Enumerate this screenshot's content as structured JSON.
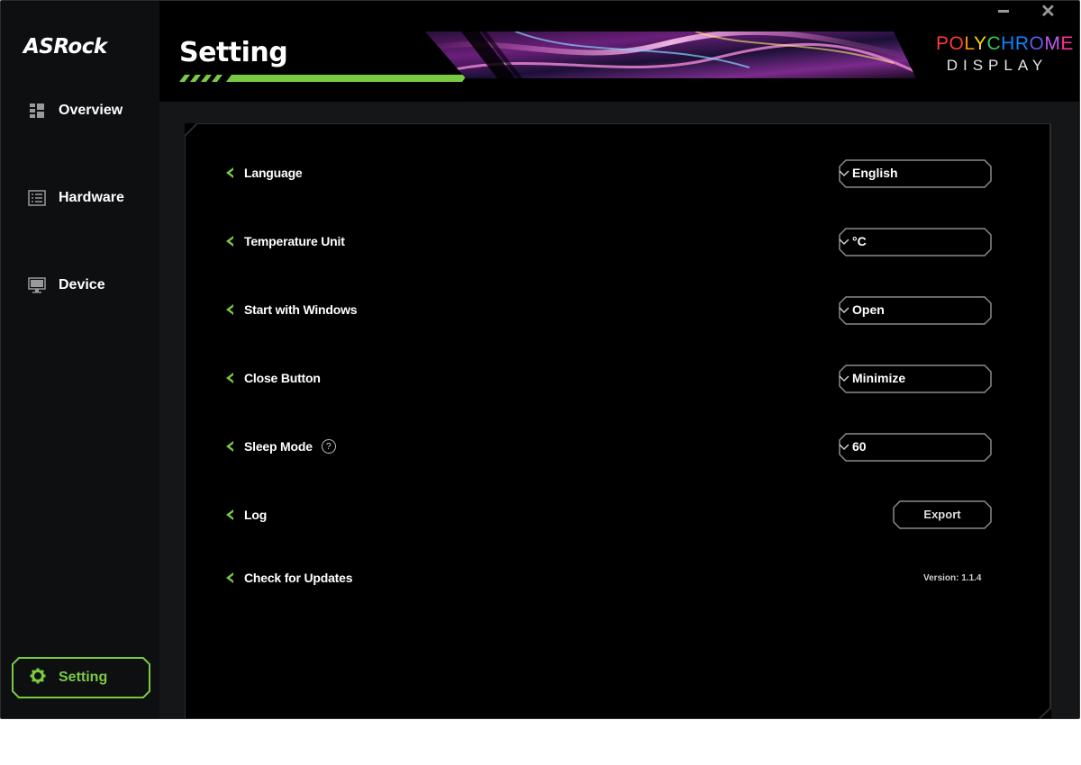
{
  "sidebar": {
    "logo": "ASRock",
    "items": [
      {
        "label": "Overview",
        "icon": "grid-icon"
      },
      {
        "label": "Hardware",
        "icon": "list-icon"
      },
      {
        "label": "Device",
        "icon": "monitor-icon"
      }
    ],
    "active": {
      "label": "Setting",
      "icon": "gear-icon"
    }
  },
  "header": {
    "title": "Setting",
    "brand_top": "POLYCHROME",
    "brand_bottom": "DISPLAY",
    "brand_colors": [
      "#ff3b30",
      "#ff9500",
      "#ffd60a",
      "#34c759",
      "#0a84ff",
      "#5e5ce6",
      "#bf5af2",
      "#ff2d92"
    ]
  },
  "settings": {
    "language": {
      "label": "Language",
      "value": "English"
    },
    "temperature": {
      "label": "Temperature Unit",
      "value": "°C"
    },
    "startup": {
      "label": "Start with Windows",
      "value": "Open"
    },
    "close": {
      "label": "Close Button",
      "value": "Minimize"
    },
    "sleep": {
      "label": "Sleep Mode",
      "value": "60",
      "help": "?"
    },
    "log": {
      "label": "Log",
      "button": "Export"
    },
    "updates": {
      "label": "Check for Updates",
      "version_label": "Version:",
      "version": "1.1.4"
    }
  },
  "colors": {
    "accent": "#7ac943",
    "background": "#000000",
    "sidebar": "#0e0f11",
    "border": "#8a8a8a"
  }
}
